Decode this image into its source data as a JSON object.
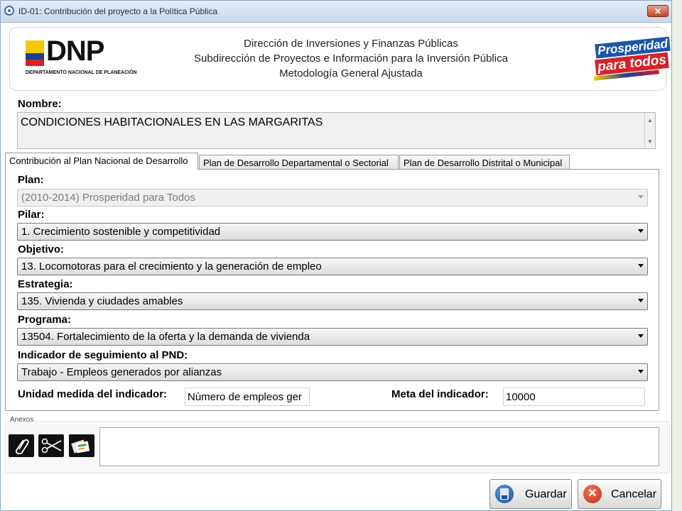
{
  "window": {
    "title": "ID-01: Contribución del proyecto a la Política Pública",
    "close_glyph": "✕"
  },
  "header": {
    "logo_text": "DNP",
    "logo_subtext": "DEPARTAMENTO NACIONAL DE PLANEACIÓN",
    "line1": "Dirección de Inversiones y Finanzas Públicas",
    "line2": "Subdirección de Proyectos e Información para la Inversión Pública",
    "line3": "Metodología General Ajustada",
    "right_logo_line1": "Prosperidad",
    "right_logo_line2": "para todos"
  },
  "nombre": {
    "label": "Nombre:",
    "value": "CONDICIONES HABITACIONALES EN LAS MARGARITAS"
  },
  "tabs": [
    {
      "label": "Contribución al Plan Nacional de Desarrollo",
      "active": true
    },
    {
      "label": "Plan de Desarrollo Departamental o Sectorial",
      "active": false
    },
    {
      "label": "Plan de Desarrollo Distrital o Municipal",
      "active": false
    }
  ],
  "form": {
    "plan": {
      "label": "Plan:",
      "value": "(2010-2014) Prosperidad para Todos",
      "disabled": true
    },
    "pilar": {
      "label": "Pilar:",
      "value": "1. Crecimiento sostenible y competitividad"
    },
    "objetivo": {
      "label": "Objetivo:",
      "value": "13. Locomotoras para el crecimiento y la generación de empleo"
    },
    "estrategia": {
      "label": "Estrategia:",
      "value": "135. Vivienda y ciudades amables"
    },
    "programa": {
      "label": "Programa:",
      "value": "13504. Fortalecimiento de la oferta y la demanda de vivienda"
    },
    "indicador": {
      "label": "Indicador de seguimiento al PND:",
      "value": "Trabajo - Empleos generados por alianzas"
    },
    "unidad": {
      "label": "Unidad medida del indicador:",
      "value": "Nùmero de empleos ger"
    },
    "meta": {
      "label": "Meta del indicador:",
      "value": "10000"
    }
  },
  "anexos": {
    "label": "Anexos",
    "tools": [
      {
        "icon": "paperclip-icon"
      },
      {
        "icon": "scissors-icon"
      },
      {
        "icon": "documents-icon"
      }
    ]
  },
  "buttons": {
    "save": "Guardar",
    "cancel": "Cancelar"
  },
  "colors": {
    "title_bar": "#c9d8ec",
    "close_button": "#c4432a",
    "flag_yellow": "#f5c800",
    "flag_blue": "#1c3f94",
    "flag_red": "#d6222a"
  }
}
